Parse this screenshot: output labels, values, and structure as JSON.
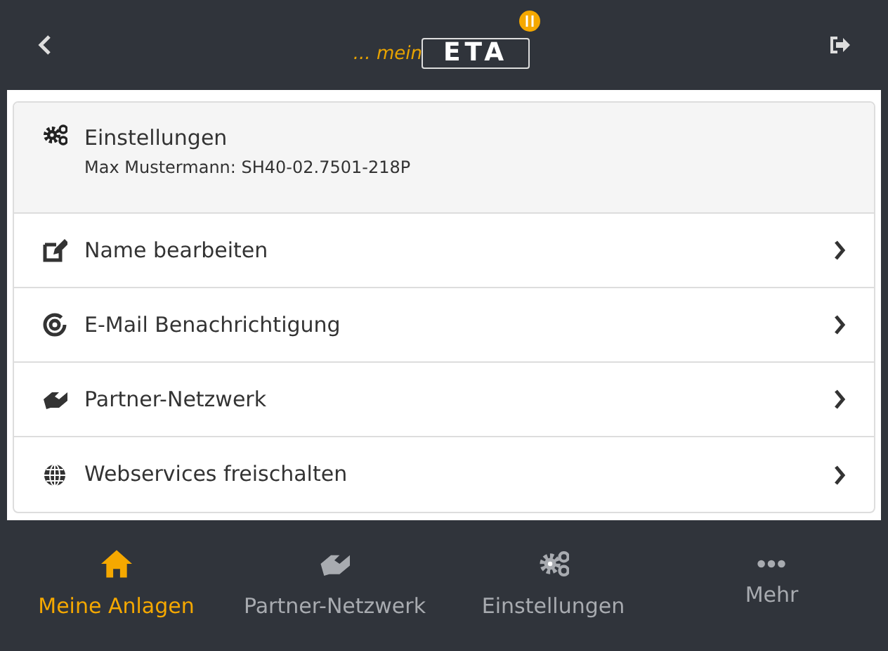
{
  "header": {
    "logo": {
      "prefix": "... mein",
      "brand": "ETA"
    }
  },
  "settings_card": {
    "title": "Einstellungen",
    "subtitle": "Max Mustermann: SH40-02.7501-218P"
  },
  "menu_items": [
    {
      "label": "Name bearbeiten"
    },
    {
      "label": "E-Mail Benachrichtigung"
    },
    {
      "label": "Partner-Netzwerk"
    },
    {
      "label": "Webservices freischalten"
    }
  ],
  "bottom_nav": [
    {
      "label": "Meine Anlagen",
      "selected": true
    },
    {
      "label": "Partner-Netzwerk",
      "selected": false
    },
    {
      "label": "Einstellungen",
      "selected": false
    },
    {
      "label": "Mehr",
      "selected": false
    }
  ]
}
